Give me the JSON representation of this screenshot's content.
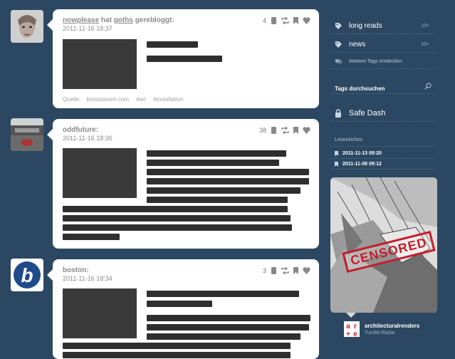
{
  "posts": [
    {
      "user": "nowplease",
      "action_text": "hat",
      "reblogged_from": "goths",
      "action_suffix": "gerebloggt:",
      "date": "2011-11-16 18:37",
      "note_count": "4",
      "source_label": "Quelle:",
      "source_url": "booooooom.com",
      "tags": [
        "#art",
        "#installation"
      ]
    },
    {
      "user": "oddfuture:",
      "date": "2011-11-16 18:36",
      "note_count": "38"
    },
    {
      "user": "boston:",
      "date": "2011-11-16 18:34",
      "note_count": "3"
    }
  ],
  "sidebar": {
    "tags": [
      {
        "label": "long reads",
        "count": "10+"
      },
      {
        "label": "news",
        "count": "10+"
      }
    ],
    "discover_label": "Weitere Tags entdecken",
    "search_label": "Tags durchsuchen",
    "safe_dash_label": "Safe Dash",
    "bookmarks_heading": "Lesezeichen",
    "bookmarks": [
      "2011-11-13 09:20",
      "2011-11-08 09:12"
    ],
    "radar": {
      "image_caption": "CENSORED",
      "user": "architecturalrenders",
      "label": "Tumblr-Radar"
    }
  }
}
